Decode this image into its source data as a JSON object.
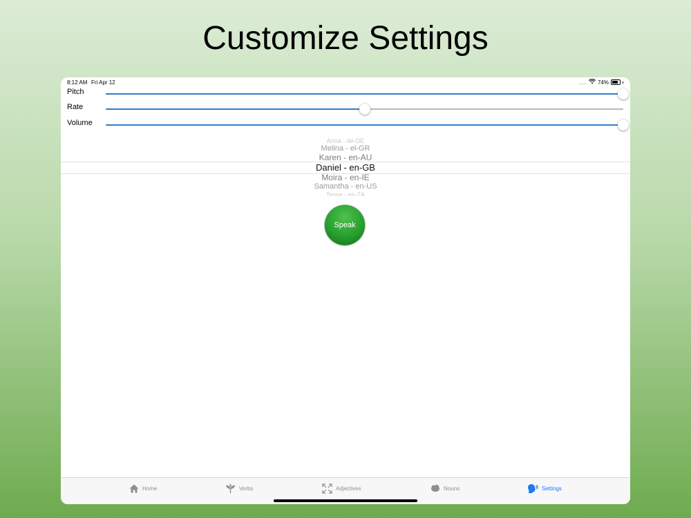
{
  "headline": "Customize Settings",
  "status_bar": {
    "time": "8:12 AM",
    "date": "Fri Apr 12",
    "signal": ".....",
    "battery": "74%"
  },
  "sliders": [
    {
      "label": "Pitch",
      "value": 1.0
    },
    {
      "label": "Rate",
      "value": 0.5
    },
    {
      "label": "Volume",
      "value": 1.0
    }
  ],
  "voice_picker": {
    "items": [
      "Anna - de-DE",
      "Melina - el-GR",
      "Karen - en-AU",
      "Daniel - en-GB",
      "Moira - en-IE",
      "Samantha - en-US",
      "Tessa - en-ZA"
    ],
    "selected": "Daniel - en-GB"
  },
  "speak_button": {
    "label": "Speak",
    "color": "#27a02d"
  },
  "tabs": [
    {
      "label": "Home",
      "icon": "home-icon"
    },
    {
      "label": "Verbs",
      "icon": "plant-icon"
    },
    {
      "label": "Adjectives",
      "icon": "expand-arrows-icon"
    },
    {
      "label": "Nouns",
      "icon": "cloud-icon"
    },
    {
      "label": "Settings",
      "icon": "speaking-head-icon",
      "active": true
    }
  ],
  "colors": {
    "accent": "#1d7bf0",
    "slider_fill": "#2f7bd2"
  }
}
